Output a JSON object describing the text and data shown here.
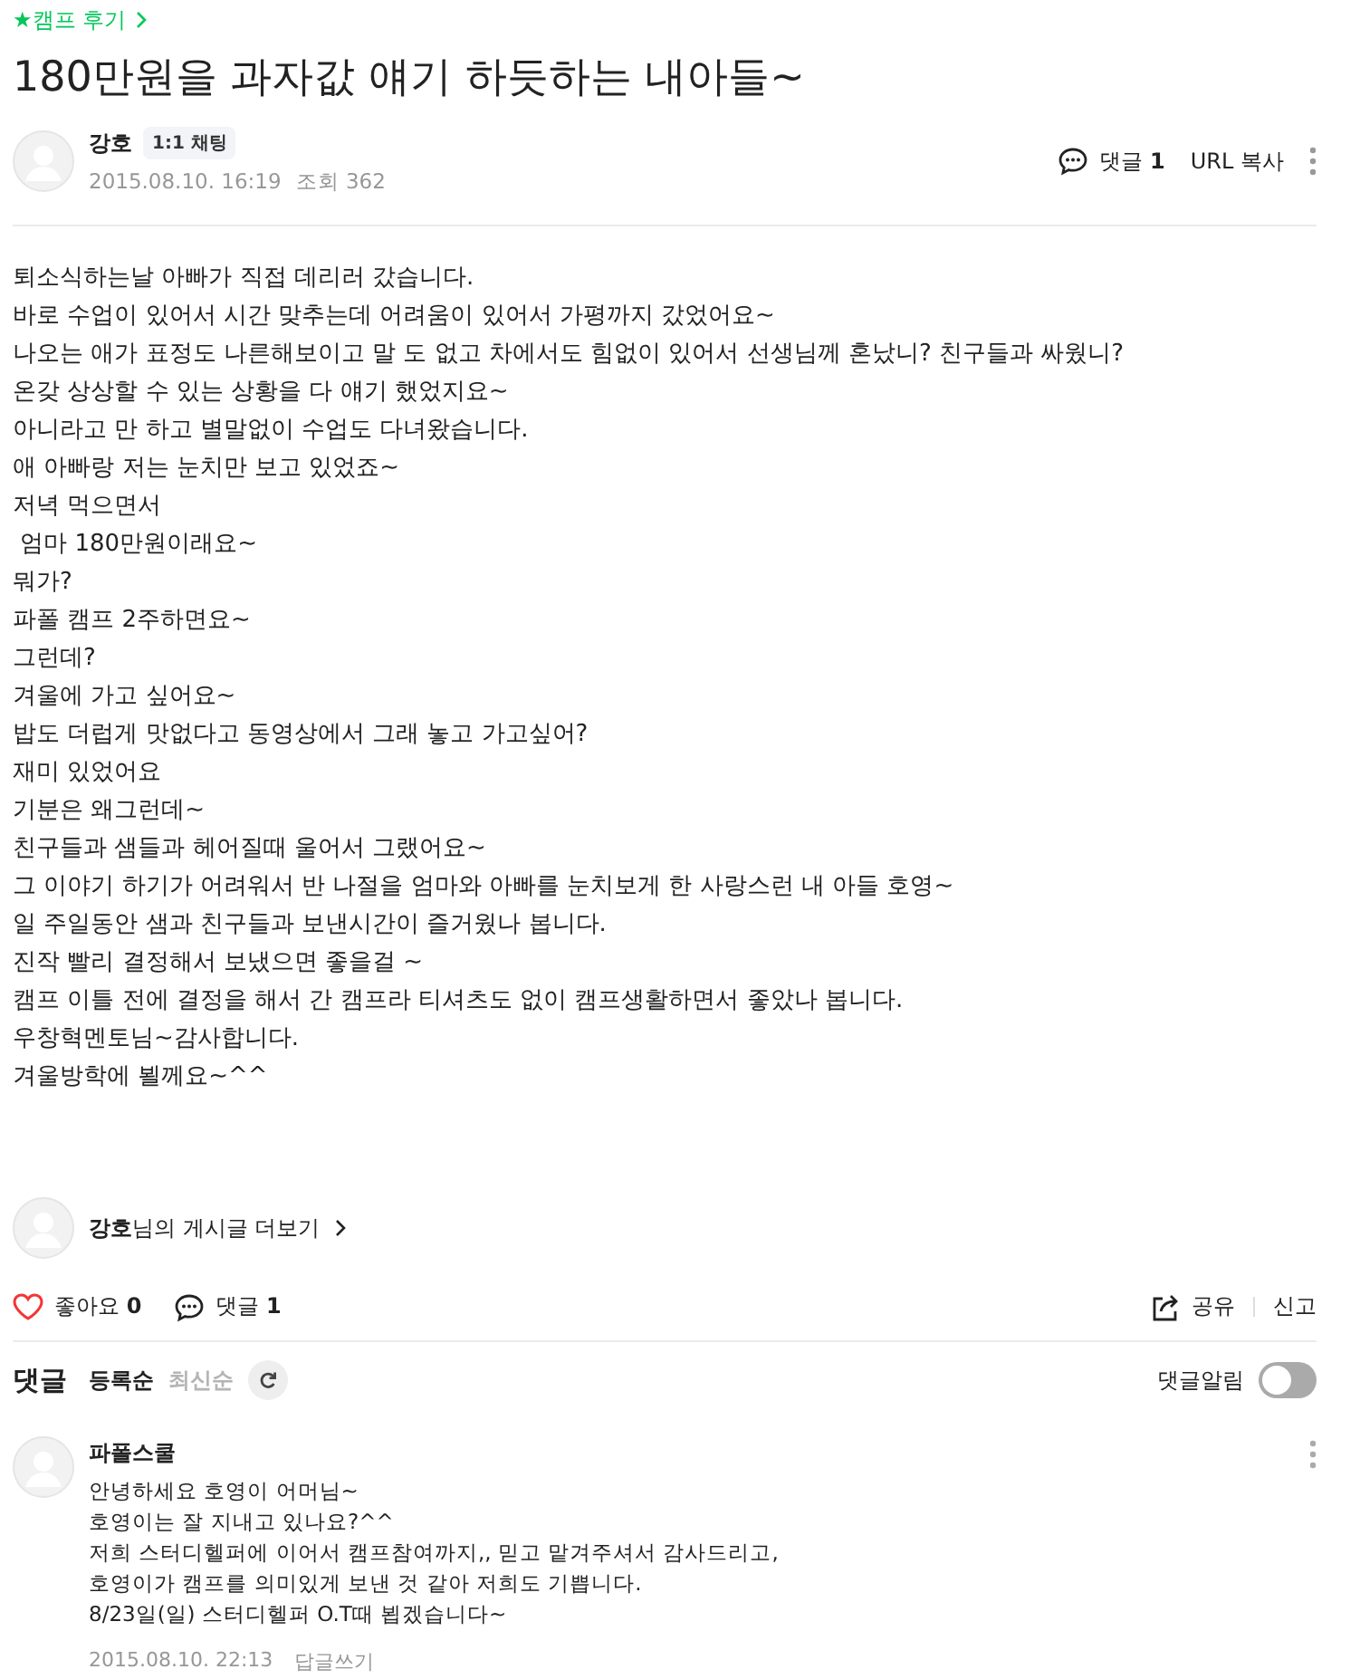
{
  "category": {
    "label": "★캠프 후기"
  },
  "title": "180만원을 과자값 얘기 하듯하는 내아들~",
  "author": {
    "name": "강호",
    "chat_badge": "1:1 채팅",
    "date": "2015.08.10. 16:19",
    "views": "조회 362"
  },
  "header_actions": {
    "comments_label": "댓글",
    "comments_count": "1",
    "url_copy": "URL 복사"
  },
  "body": [
    "퇴소식하는날 아빠가 직접 데리러 갔습니다.",
    "바로 수업이 있어서 시간 맞추는데 어려움이 있어서 가평까지 갔었어요~",
    "나오는 애가 표정도 나른해보이고 말 도 없고 차에서도 힘없이 있어서 선생님께 혼났니? 친구들과 싸웠니?",
    "온갖 상상할 수 있는 상황을 다 얘기 했었지요~",
    "아니라고 만 하고 별말없이 수업도 다녀왔습니다.",
    "애 아빠랑 저는 눈치만 보고 있었죠~",
    "저녁 먹으면서",
    " 엄마 180만원이래요~",
    "뭐가?",
    "파폴 캠프 2주하면요~",
    "그런데?",
    "겨울에 가고 싶어요~",
    "밥도 더럽게 맛없다고 동영상에서 그래 놓고 가고싶어?",
    "재미 있었어요",
    "기분은 왜그런데~",
    "친구들과 샘들과 헤어질때 울어서 그랬어요~",
    "그 이야기 하기가 어려워서 반 나절을 엄마와 아빠를 눈치보게 한 사랑스런 내 아들 호영~",
    "일 주일동안 샘과 친구들과 보낸시간이 즐거웠나 봅니다.",
    "진작 빨리 결정해서 보냈으면 좋을걸 ~",
    "캠프 이틀 전에 결정을 해서 간 캠프라 티셔츠도 없이 캠프생활하면서 좋았나 봅니다.",
    "우창혁멘토님~감사합니다.",
    "겨울방학에 뵐께요~^^"
  ],
  "more_posts": "**강호**님의 게시글 더보기",
  "footer_actions": {
    "like_label": "좋아요",
    "like_count": "0",
    "liked": false,
    "comment_label": "댓글",
    "comment_count": "1",
    "share": "공유",
    "report": "신고"
  },
  "comments_section": {
    "title": "댓글",
    "sort_tabs": [
      {
        "label": "등록순",
        "selected": true
      },
      {
        "label": "최신순",
        "selected": false
      }
    ],
    "notify_label": "댓글알림",
    "notify_on": false
  },
  "comments": [
    {
      "author": "파폴스쿨",
      "lines": [
        "안녕하세요 호영이 어머님~",
        "호영이는 잘 지내고 있나요?^^",
        "저희 스터디헬퍼에 이어서 캠프참여까지,, 믿고 맡겨주셔서 감사드리고,",
        "호영이가 캠프를 의미있게 보낸 것 같아 저희도 기쁩니다.",
        "8/23일(일) 스터디헬퍼 O.T때 뵙겠습니다~"
      ],
      "date": "2015.08.10. 22:13",
      "reply": "답글쓰기"
    }
  ]
}
